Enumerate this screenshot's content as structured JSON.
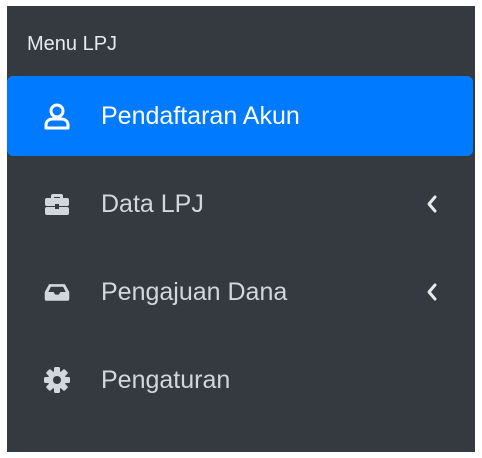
{
  "sidebar": {
    "header": "Menu LPJ",
    "items": [
      {
        "label": "Pendaftaran Akun",
        "icon": "user-icon",
        "active": true,
        "has_submenu": false
      },
      {
        "label": "Data LPJ",
        "icon": "briefcase-icon",
        "active": false,
        "has_submenu": true
      },
      {
        "label": "Pengajuan Dana",
        "icon": "inbox-icon",
        "active": false,
        "has_submenu": true
      },
      {
        "label": "Pengaturan",
        "icon": "gear-icon",
        "active": false,
        "has_submenu": false
      }
    ]
  },
  "colors": {
    "sidebar_bg": "#343a40",
    "active_bg": "#007bff",
    "text": "#d3d7db"
  }
}
